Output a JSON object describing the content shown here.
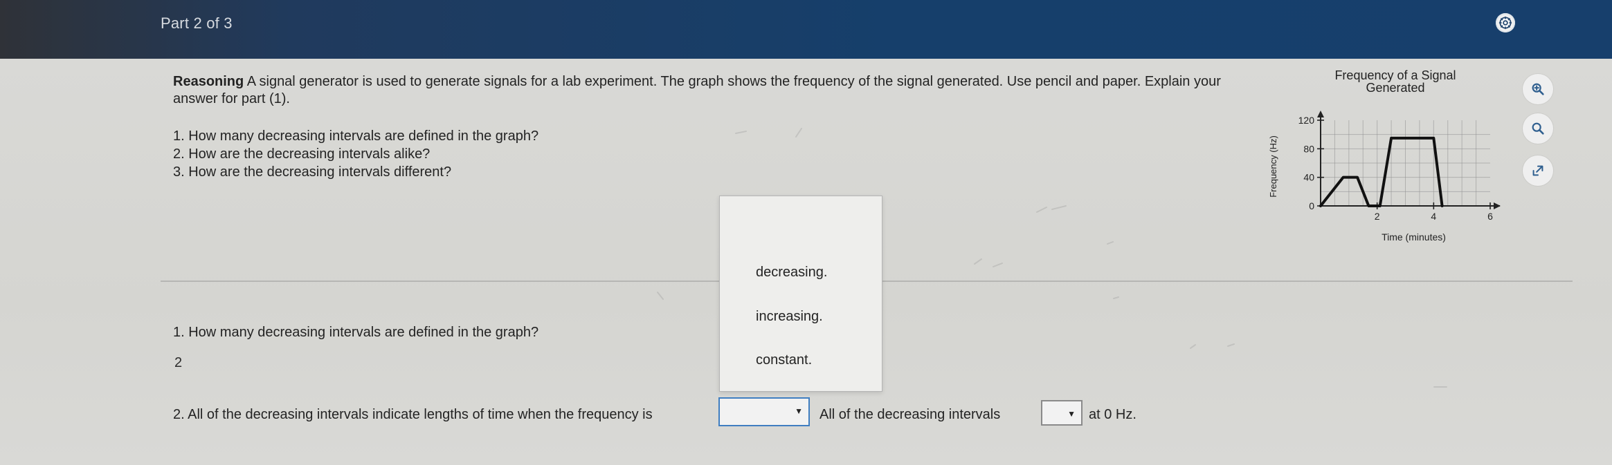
{
  "header": {
    "part_label": "Part 2 of 3",
    "settings_icon": "gear-icon"
  },
  "content": {
    "reasoning_label": "Reasoning",
    "reasoning_text": "A signal generator is used to generate signals for a lab experiment. The graph shows the frequency of the signal generated. Use pencil and paper. Explain your answer for part (1).",
    "questions": [
      "1. How many decreasing intervals are defined in the graph?",
      "2. How are the decreasing intervals alike?",
      "3. How are the decreasing intervals different?"
    ],
    "question_1_repeat": "1. How many decreasing intervals are defined in the graph?",
    "answer_value": "2",
    "sentence_part_1": "2. All of the decreasing intervals indicate lengths of time when the frequency is",
    "sentence_part_2": "All of the decreasing intervals",
    "sentence_part_3": "at 0 Hz."
  },
  "dropdown": {
    "options": [
      "decreasing.",
      "increasing.",
      "constant."
    ]
  },
  "tools": [
    {
      "icon": "zoom-in-icon"
    },
    {
      "icon": "search-icon"
    },
    {
      "icon": "expand-icon"
    }
  ],
  "chart_data": {
    "type": "line",
    "title": "Frequency of a Signal Generated",
    "xlabel": "Time (minutes)",
    "ylabel": "Frequency (Hz)",
    "x": [
      0,
      0.8,
      1.3,
      1.7,
      2.1,
      2.5,
      4.0,
      4.3
    ],
    "y": [
      0,
      40,
      40,
      0,
      0,
      95,
      95,
      0
    ],
    "x_ticks": [
      2,
      4,
      6
    ],
    "y_ticks": [
      0,
      40,
      80,
      120
    ],
    "xlim": [
      0,
      6
    ],
    "ylim": [
      0,
      120
    ],
    "grid": true
  }
}
